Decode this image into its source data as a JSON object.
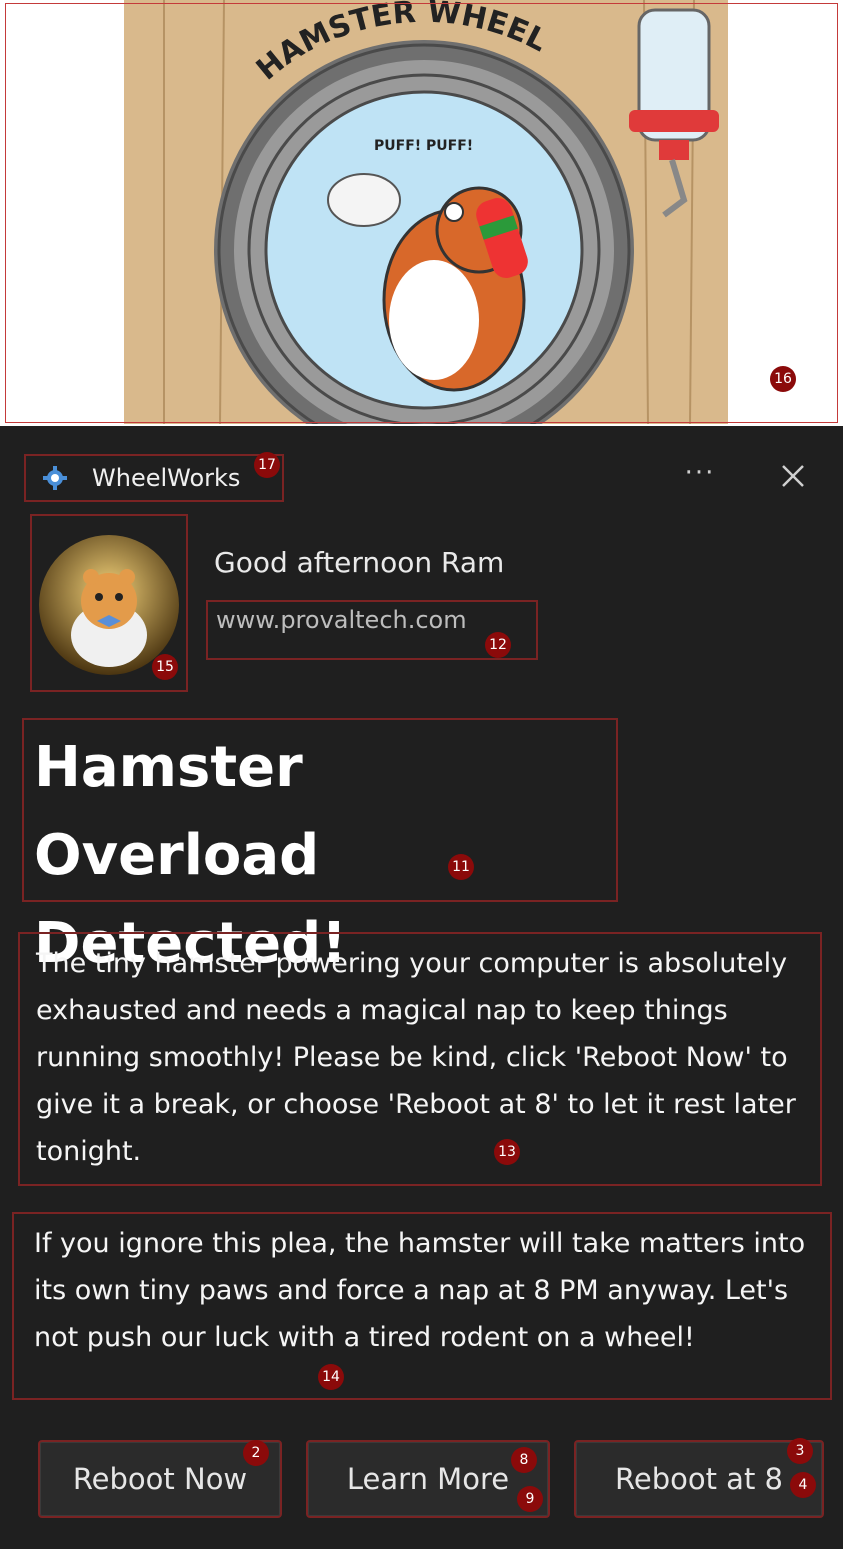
{
  "hero": {
    "sign_text": "HAMSTER WHEEL",
    "speech_text": "PUFF! PUFF!"
  },
  "app": {
    "name": "WheelWorks",
    "more_label": "···",
    "close_label": "Close"
  },
  "header": {
    "greeting": "Good afternoon Ram",
    "url": "www.provaltech.com"
  },
  "notification": {
    "title": "Hamster Overload Detected!",
    "body": "The tiny hamster powering your computer is absolutely exhausted and needs a magical nap to keep things running smoothly! Please be kind, click 'Reboot Now' to give it a break, or choose 'Reboot at 8' to let it rest later tonight.",
    "warning": "If you ignore this plea, the hamster will take matters into its own tiny paws and force a nap at 8 PM anyway. Let's not push our luck with a tired rodent on a wheel!"
  },
  "buttons": {
    "reboot_now": "Reboot Now",
    "learn_more": "Learn More",
    "reboot_at_8": "Reboot at 8"
  },
  "badges": {
    "b2": "2",
    "b3": "3",
    "b4": "4",
    "b8": "8",
    "b9": "9",
    "b11": "11",
    "b12": "12",
    "b13": "13",
    "b14": "14",
    "b15": "15",
    "b16": "16",
    "b17": "17"
  },
  "colors": {
    "background": "#1f1f1f",
    "annotation_border": "#7a2323",
    "badge": "#8b0a0a",
    "button": "#2b2b2b"
  }
}
